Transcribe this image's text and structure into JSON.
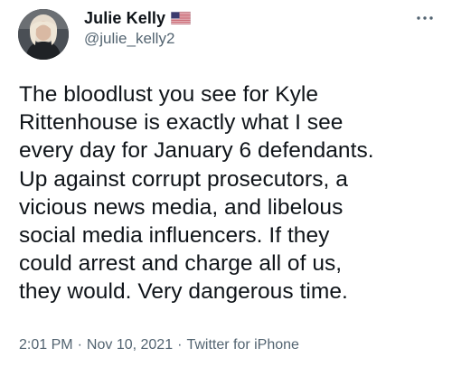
{
  "author": {
    "display_name": "Julie Kelly",
    "handle": "@julie_kelly2",
    "avatar": "profile-photo",
    "flag": "us-flag-icon"
  },
  "tweet": {
    "text": "The bloodlust you see for Kyle\nRittenhouse is exactly what I see\nevery day for January 6 defendants.\nUp against corrupt prosecutors, a\nvicious news media, and libelous\nsocial media influencers. If they\ncould arrest and charge all of us,\nthey would. Very dangerous time."
  },
  "meta": {
    "time": "2:01 PM",
    "date": "Nov 10, 2021",
    "source": "Twitter for iPhone",
    "separator": "·"
  },
  "menu": {
    "icon": "more-icon"
  },
  "colors": {
    "text": "#0f1419",
    "secondary": "#536471",
    "background": "#ffffff"
  }
}
